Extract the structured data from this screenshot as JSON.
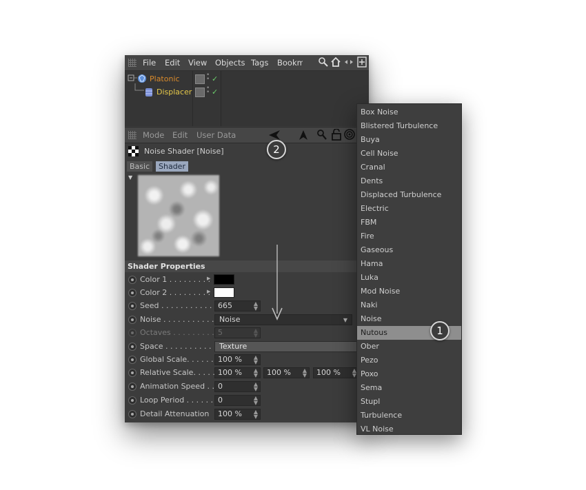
{
  "menubar": {
    "items": [
      "File",
      "Edit",
      "View",
      "Objects",
      "Tags",
      "Bookm"
    ]
  },
  "objects": [
    {
      "name": "Platonic",
      "color": "#d98a2b"
    },
    {
      "name": "Displacer",
      "color": "#e5c84a"
    }
  ],
  "attributes": {
    "menu": [
      "Mode",
      "Edit",
      "User Data"
    ],
    "title": "Noise Shader [Noise]",
    "tabs": [
      {
        "label": "Basic",
        "active": false
      },
      {
        "label": "Shader",
        "active": true
      }
    ],
    "section_title": "Shader Properties",
    "properties": {
      "color1": {
        "label": "Color 1 . . . . . . . . .",
        "value_color": "#000000"
      },
      "color2": {
        "label": "Color 2 . . . . . . . . .",
        "value_color": "#ffffff"
      },
      "seed": {
        "label": "Seed . . . . . . . . . . . . .",
        "value": "665"
      },
      "noise": {
        "label": "Noise . . . . . . . . . . . .",
        "value": "Noise"
      },
      "octaves": {
        "label": "Octaves . . . . . . . . . .",
        "value": "5"
      },
      "space": {
        "label": "Space . . . . . . . . . . . .",
        "value": "Texture"
      },
      "global_scale": {
        "label": "Global Scale. . . . . . .",
        "value": "100 %"
      },
      "relative_scale": {
        "label": "Relative Scale. . . . . .",
        "values": [
          "100 %",
          "100 %",
          "100 %"
        ]
      },
      "animation_speed": {
        "label": "Animation Speed . .",
        "value": "0"
      },
      "loop_period": {
        "label": "Loop Period . . . . . . .",
        "value": "0"
      },
      "detail_attenuation": {
        "label": "Detail Attenuation",
        "value": "100 %"
      }
    }
  },
  "noise_menu": {
    "selected": "Nutous",
    "items": [
      "Box Noise",
      "Blistered Turbulence",
      "Buya",
      "Cell Noise",
      "Cranal",
      "Dents",
      "Displaced Turbulence",
      "Electric",
      "FBM",
      "Fire",
      "Gaseous",
      "Hama",
      "Luka",
      "Mod Noise",
      "Naki",
      "Noise",
      "Nutous",
      "Ober",
      "Pezo",
      "Poxo",
      "Sema",
      "Stupl",
      "Turbulence",
      "VL Noise"
    ]
  },
  "annotations": {
    "badge_1": "1",
    "badge_2": "2"
  },
  "icons": [
    "grip-icon",
    "search-icon",
    "home-icon",
    "arrows-icon",
    "new-window-icon",
    "platonic-icon",
    "displacer-icon",
    "back-arrow-icon",
    "up-arrow-icon",
    "lock-icon",
    "target-icon",
    "checker-icon",
    "checkmark-icon",
    "dropdown-caret-icon"
  ]
}
